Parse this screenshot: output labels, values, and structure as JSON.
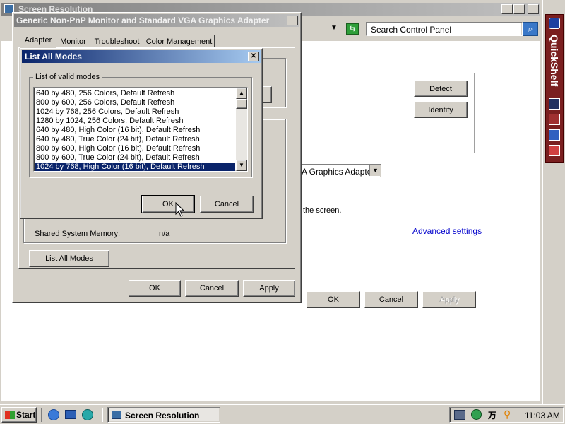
{
  "main_window": {
    "title": "Screen Resolution",
    "search_placeholder": "Search Control Panel",
    "detect_label": "Detect",
    "identify_label": "Identify",
    "adapter_select_value": "A Graphics Adapter",
    "screen_text": "the screen.",
    "advanced_link": "Advanced settings",
    "ok_label": "OK",
    "cancel_label": "Cancel",
    "apply_label": "Apply"
  },
  "props_dialog": {
    "title": "Generic Non-PnP Monitor and Standard VGA Graphics Adapter P...",
    "tabs": [
      {
        "label": "Adapter"
      },
      {
        "label": "Monitor"
      },
      {
        "label": "Troubleshoot"
      },
      {
        "label": "Color Management"
      }
    ],
    "shared_label": "Shared System Memory:",
    "shared_value": "n/a",
    "list_all_modes_label": "List All Modes",
    "ok_label": "OK",
    "cancel_label": "Cancel",
    "apply_label": "Apply"
  },
  "modes_dialog": {
    "title": "List All Modes",
    "group_label": "List of valid modes",
    "modes": [
      "640 by 480, 256 Colors, Default Refresh",
      "800 by 600, 256 Colors, Default Refresh",
      "1024 by 768, 256 Colors, Default Refresh",
      "1280 by 1024, 256 Colors, Default Refresh",
      "640 by 480, High Color (16 bit), Default Refresh",
      "640 by 480, True Color (24 bit), Default Refresh",
      "800 by 600, High Color (16 bit), Default Refresh",
      "800 by 600, True Color (24 bit), Default Refresh",
      "1024 by 768, High Color (16 bit), Default Refresh"
    ],
    "selected_index": 8,
    "ok_label": "OK",
    "cancel_label": "Cancel"
  },
  "quickshelf": {
    "label": "QuickShelf"
  },
  "taskbar": {
    "start_label": "Start",
    "task_label": "Screen Resolution",
    "clock": "11:03 AM"
  },
  "colors": {
    "title_active": "#0a246a",
    "face": "#d4d0c8",
    "desktop": "#ffffff"
  }
}
